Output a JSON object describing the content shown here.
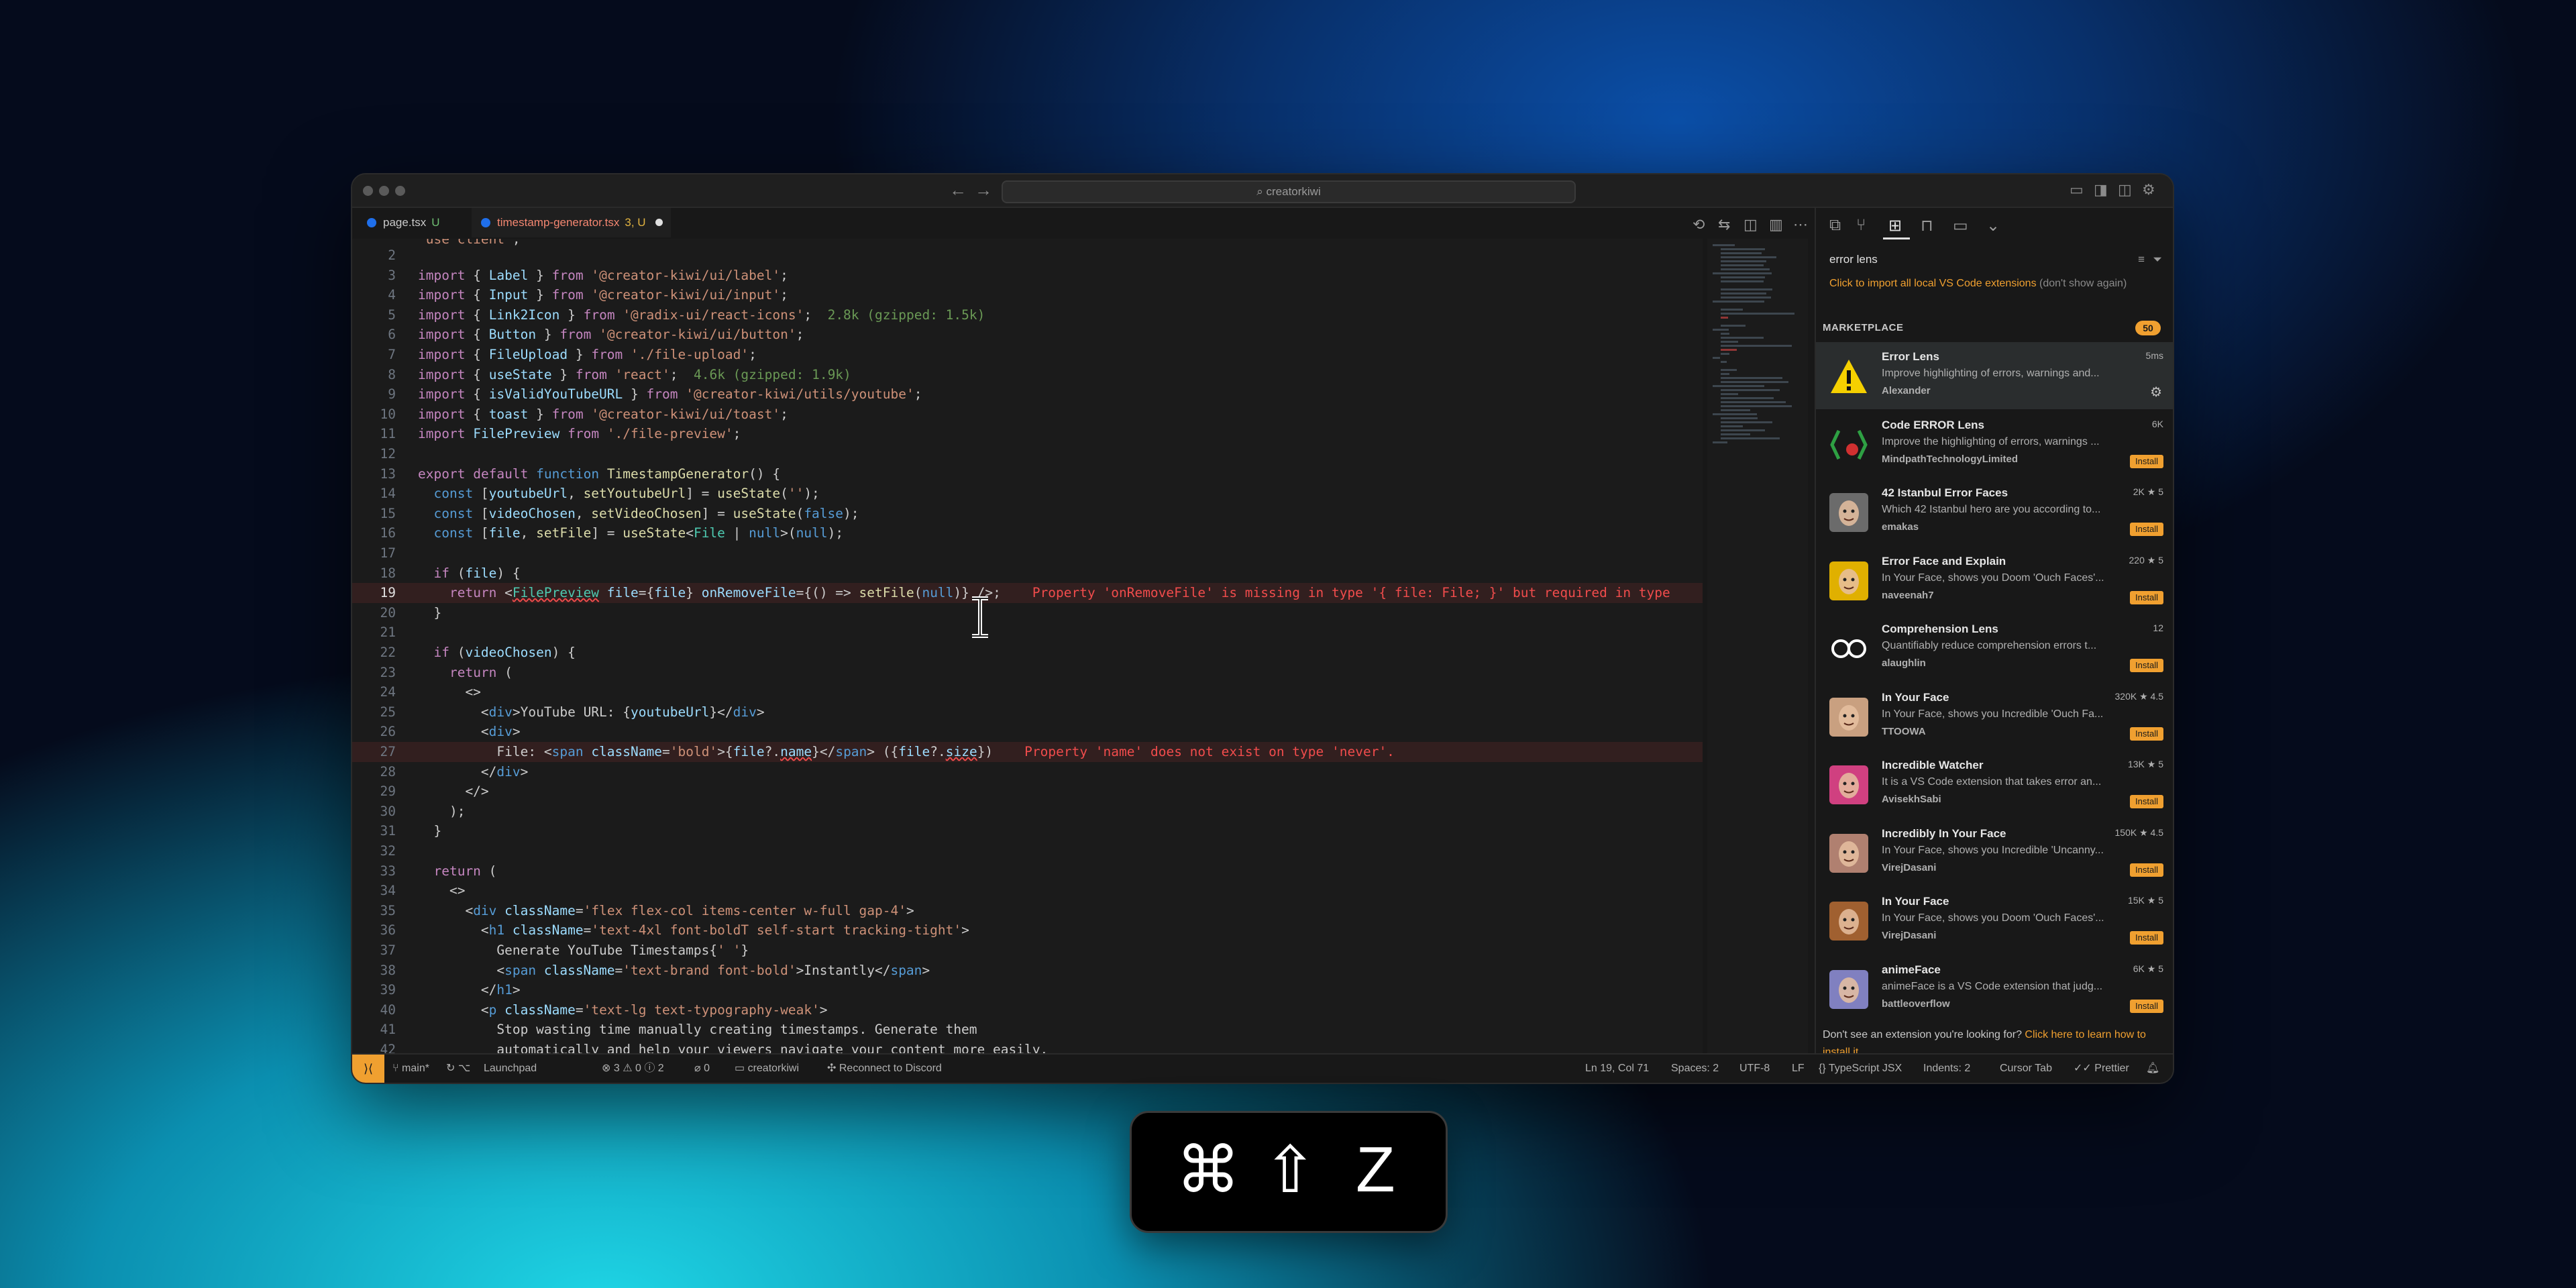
{
  "window": {
    "search": "creatorkiwi"
  },
  "tabs": [
    {
      "name": "page.tsx",
      "badge": "U",
      "active": false
    },
    {
      "name": "timestamp-generator.tsx",
      "badge": "3, U",
      "active": true
    }
  ],
  "code": [
    {
      "n": "2",
      "html": ""
    },
    {
      "n": "3",
      "html": "<span class=\"k\">import</span> { <span class=\"v\">Label</span> } <span class=\"k\">from</span> <span class=\"s\">'@creator-kiwi/ui/label'</span>;"
    },
    {
      "n": "4",
      "html": "<span class=\"k\">import</span> { <span class=\"v\">Input</span> } <span class=\"k\">from</span> <span class=\"s\">'@creator-kiwi/ui/input'</span>;"
    },
    {
      "n": "5",
      "html": "<span class=\"k\">import</span> { <span class=\"v\">Link2Icon</span> } <span class=\"k\">from</span> <span class=\"s\">'@radix-ui/react-icons'</span>;  <span class=\"g\">2.8k (gzipped: 1.5k)</span>"
    },
    {
      "n": "6",
      "html": "<span class=\"k\">import</span> { <span class=\"v\">Button</span> } <span class=\"k\">from</span> <span class=\"s\">'@creator-kiwi/ui/button'</span>;"
    },
    {
      "n": "7",
      "html": "<span class=\"k\">import</span> { <span class=\"v\">FileUpload</span> } <span class=\"k\">from</span> <span class=\"s\">'./file-upload'</span>;"
    },
    {
      "n": "8",
      "html": "<span class=\"k\">import</span> { <span class=\"v\">useState</span> } <span class=\"k\">from</span> <span class=\"s\">'react'</span>;  <span class=\"g\">4.6k (gzipped: 1.9k)</span>"
    },
    {
      "n": "9",
      "html": "<span class=\"k\">import</span> { <span class=\"v\">isValidYouTubeURL</span> } <span class=\"k\">from</span> <span class=\"s\">'@creator-kiwi/utils/youtube'</span>;"
    },
    {
      "n": "10",
      "html": "<span class=\"k\">import</span> { <span class=\"v\">toast</span> } <span class=\"k\">from</span> <span class=\"s\">'@creator-kiwi/ui/toast'</span>;"
    },
    {
      "n": "11",
      "html": "<span class=\"k\">import</span> <span class=\"v\">FilePreview</span> <span class=\"k\">from</span> <span class=\"s\">'./file-preview'</span>;"
    },
    {
      "n": "12",
      "html": ""
    },
    {
      "n": "13",
      "html": "<span class=\"k\">export</span> <span class=\"k\">default</span> <span class=\"ki\">function</span> <span class=\"f\">TimestampGenerator</span>() {"
    },
    {
      "n": "14",
      "html": "  <span class=\"ki\">const</span> [<span class=\"v\">youtubeUrl</span>, <span class=\"f\">setYoutubeUrl</span>] = <span class=\"f\">useState</span>(<span class=\"s\">''</span>);"
    },
    {
      "n": "15",
      "html": "  <span class=\"ki\">const</span> [<span class=\"v\">videoChosen</span>, <span class=\"f\">setVideoChosen</span>] = <span class=\"f\">useState</span>(<span class=\"ki\">false</span>);"
    },
    {
      "n": "16",
      "html": "  <span class=\"ki\">const</span> [<span class=\"v\">file</span>, <span class=\"f\">setFile</span>] = <span class=\"f\">useState</span>&lt;<span class=\"t\">File</span> | <span class=\"ki\">null</span>&gt;(<span class=\"ki\">null</span>);"
    },
    {
      "n": "17",
      "html": ""
    },
    {
      "n": "18",
      "html": "  <span class=\"k\">if</span> (<span class=\"v\">file</span>) {"
    },
    {
      "n": "19",
      "html": "    <span class=\"k\">return</span> &lt;<span class=\"tag squig\">FilePreview</span> <span class=\"attr\">file</span>={<span class=\"v\">file</span>} <span class=\"attr\">onRemoveFile</span>={() =&gt; <span class=\"f\">setFile</span>(<span class=\"ki\">null</span>)} /&gt;;    <span class=\"msg\">Property 'onRemoveFile' is missing in type '{ file: File; }' but required in type</span>",
      "err": true,
      "cur": true
    },
    {
      "n": "20",
      "html": "  }"
    },
    {
      "n": "21",
      "html": ""
    },
    {
      "n": "22",
      "html": "  <span class=\"k\">if</span> (<span class=\"v\">videoChosen</span>) {"
    },
    {
      "n": "23",
      "html": "    <span class=\"k\">return</span> ("
    },
    {
      "n": "24",
      "html": "      &lt;&gt;"
    },
    {
      "n": "25",
      "html": "        &lt;<span class=\"ki\">div</span>&gt;YouTube URL: {<span class=\"v\">youtubeUrl</span>}&lt;/<span class=\"ki\">div</span>&gt;"
    },
    {
      "n": "26",
      "html": "        &lt;<span class=\"ki\">div</span>&gt;"
    },
    {
      "n": "27",
      "html": "          File: &lt;<span class=\"ki\">span</span> <span class=\"attr\">className</span>=<span class=\"s\">'bold'</span>&gt;{<span class=\"v\">file</span>?.<span class=\"v squig\">name</span>}&lt;/<span class=\"ki\">span</span>&gt; ({<span class=\"v\">file</span>?.<span class=\"v squig\">size</span>})    <span class=\"msg\">Property 'name' does not exist on type 'never'.</span>",
      "err": true
    },
    {
      "n": "28",
      "html": "        &lt;/<span class=\"ki\">div</span>&gt;"
    },
    {
      "n": "29",
      "html": "      &lt;/&gt;"
    },
    {
      "n": "30",
      "html": "    );"
    },
    {
      "n": "31",
      "html": "  }"
    },
    {
      "n": "32",
      "html": ""
    },
    {
      "n": "33",
      "html": "  <span class=\"k\">return</span> ("
    },
    {
      "n": "34",
      "html": "    &lt;&gt;"
    },
    {
      "n": "35",
      "html": "      &lt;<span class=\"ki\">div</span> <span class=\"attr\">className</span>=<span class=\"s\">'flex flex-col items-center w-full gap-4'</span>&gt;"
    },
    {
      "n": "36",
      "html": "        &lt;<span class=\"ki\">h1</span> <span class=\"attr\">className</span>=<span class=\"s\">'text-4xl font-boldT self-start tracking-tight'</span>&gt;"
    },
    {
      "n": "37",
      "html": "          Generate YouTube Timestamps{<span class=\"s\">' '</span>}"
    },
    {
      "n": "38",
      "html": "          &lt;<span class=\"ki\">span</span> <span class=\"attr\">className</span>=<span class=\"s\">'text-brand font-bold'</span>&gt;Instantly&lt;/<span class=\"ki\">span</span>&gt;"
    },
    {
      "n": "39",
      "html": "        &lt;/<span class=\"ki\">h1</span>&gt;"
    },
    {
      "n": "40",
      "html": "        &lt;<span class=\"ki\">p</span> <span class=\"attr\">className</span>=<span class=\"s\">'text-lg text-typography-weak'</span>&gt;"
    },
    {
      "n": "41",
      "html": "          Stop wasting time manually creating timestamps. Generate them"
    },
    {
      "n": "42",
      "html": "          automatically and help your viewers navigate your content more easily."
    }
  ],
  "sidebar": {
    "search": "error lens",
    "import_link": "Click to import all local VS Code extensions",
    "import_note": "(don't show again)",
    "marketplace_label": "MARKETPLACE",
    "marketplace_count": "50",
    "install_label": "Install",
    "footer_text": "Don't see an extension you're looking for?",
    "footer_link": "Click here to learn how to install it.",
    "extensions": [
      {
        "name": "Error Lens",
        "desc": "Improve highlighting of errors, warnings and...",
        "publisher": "Alexander",
        "stat": "5ms",
        "installed": true,
        "icon": "warning-triangle-icon",
        "color": "#f5d000"
      },
      {
        "name": "Code ERROR Lens",
        "desc": "Improve the highlighting of errors, warnings ...",
        "publisher": "MindpathTechnologyLimited",
        "stat": "6K",
        "installed": false,
        "icon": "code-error-lens-icon",
        "color": "#2ea043"
      },
      {
        "name": "42 Istanbul Error Faces",
        "desc": "Which 42 Istanbul hero are you according to...",
        "publisher": "emakas",
        "stat": "2K ★ 5",
        "installed": false,
        "icon": "face-photo-icon",
        "color": "#6b6b6b"
      },
      {
        "name": "Error Face and Explain",
        "desc": "In Your Face, shows you Doom 'Ouch Faces'...",
        "publisher": "naveenah7",
        "stat": "220 ★ 5",
        "installed": false,
        "icon": "doom-face-icon",
        "color": "#e0b000"
      },
      {
        "name": "Comprehension Lens",
        "desc": "Quantifiably reduce comprehension errors t...",
        "publisher": "alaughlin",
        "stat": "12",
        "installed": false,
        "icon": "glasses-icon",
        "color": "#ffffff"
      },
      {
        "name": "In Your Face",
        "desc": "In Your Face, shows you Incredible 'Ouch Fa...",
        "publisher": "TTOOWA",
        "stat": "320K ★ 4.5",
        "installed": false,
        "icon": "incredible-face-icon",
        "color": "#c9a080"
      },
      {
        "name": "Incredible Watcher",
        "desc": "It is a VS Code extension that takes error an...",
        "publisher": "AvisekhSabi",
        "stat": "13K ★ 5",
        "installed": false,
        "icon": "incredible-watcher-icon",
        "color": "#d04080"
      },
      {
        "name": "Incredibly In Your Face",
        "desc": "In Your Face, shows you Incredible 'Uncanny...",
        "publisher": "VirejDasani",
        "stat": "150K ★ 4.5",
        "installed": false,
        "icon": "incredible-face-icon",
        "color": "#b08070"
      },
      {
        "name": "In Your Face",
        "desc": "In Your Face, shows you Doom 'Ouch Faces'...",
        "publisher": "VirejDasani",
        "stat": "15K ★ 5",
        "installed": false,
        "icon": "doom-face-icon",
        "color": "#a06030"
      },
      {
        "name": "animeFace",
        "desc": "animeFace is a VS Code extension that judg...",
        "publisher": "battleoverflow",
        "stat": "6K ★ 5",
        "installed": false,
        "icon": "anime-face-icon",
        "color": "#8080c0"
      }
    ]
  },
  "status": {
    "branch": "main*",
    "launchpad": "Launchpad",
    "problems": "⊗ 3 ⚠ 0 ⓘ 2",
    "ports": "⌀ 0",
    "project": "creatorkiwi",
    "discord": "Reconnect to Discord",
    "position": "Ln 19, Col 71",
    "spaces": "Spaces: 2",
    "encoding": "UTF-8",
    "eol": "LF",
    "language": "TypeScript JSX",
    "indents": "Indents: 2",
    "cursor_tab": "Cursor Tab",
    "prettier": "Prettier"
  },
  "shortcut": {
    "cmd": "⌘",
    "shift": "⇧",
    "key": "Z"
  },
  "colors": {
    "accent": "#f0a030",
    "error": "#f14c4c",
    "background": "#181818"
  }
}
